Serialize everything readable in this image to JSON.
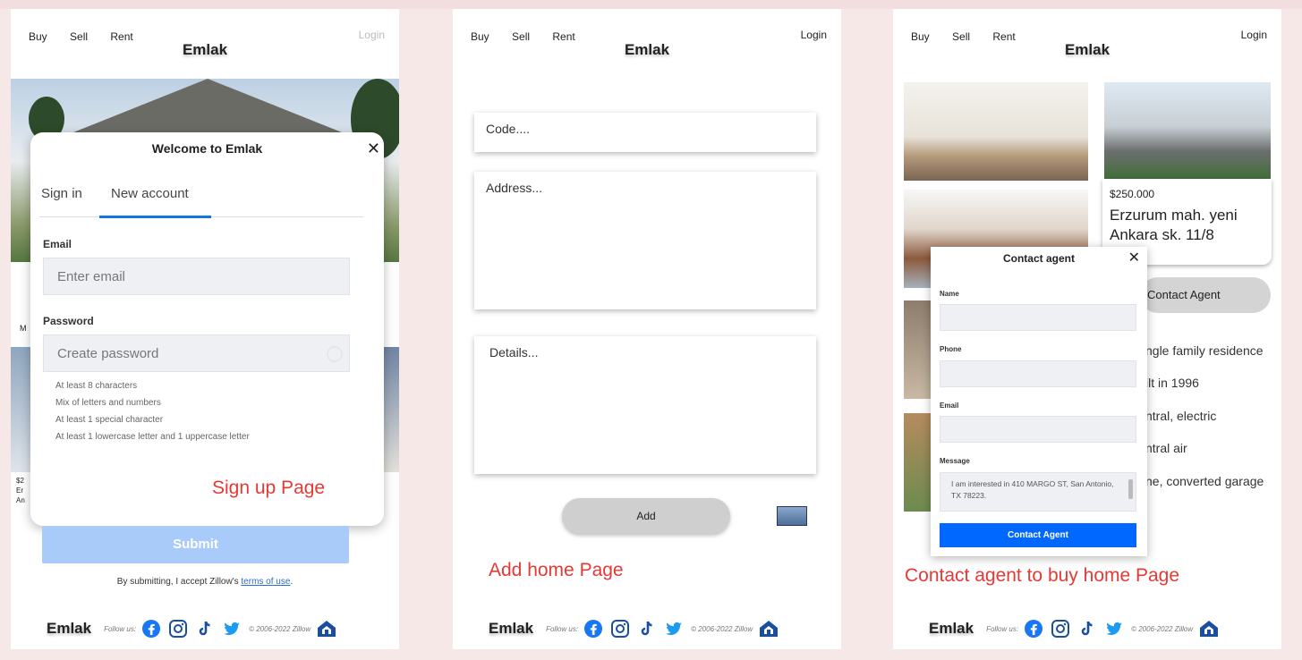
{
  "nav": {
    "buy": "Buy",
    "sell": "Sell",
    "rent": "Rent",
    "login": "Login",
    "brand": "Emlak"
  },
  "footer": {
    "brand": "Emlak",
    "follow": "Follow us:",
    "copyright": "© 2006-2022 Zillow"
  },
  "signup": {
    "title": "Welcome to Emlak",
    "close": "✕",
    "tab_signin": "Sign in",
    "tab_new": "New account",
    "email_label": "Email",
    "email_placeholder": "Enter email",
    "password_label": "Password",
    "password_placeholder": "Create password",
    "rules": [
      "At least 8 characters",
      "Mix of letters and numbers",
      "At least 1 special character",
      "At least 1 lowercase letter and 1 uppercase letter"
    ],
    "submit": "Submit",
    "terms_prefix": "By submitting, I accept Zillow's ",
    "terms_link": "terms of use",
    "terms_suffix": ".",
    "caption": "Sign up Page",
    "bg_card_lines": [
      "$2",
      "Er",
      "An"
    ],
    "bg_letter": "M"
  },
  "addhome": {
    "code_placeholder": "Code....",
    "address_placeholder": "Address...",
    "details_placeholder": "Details...",
    "add_button": "Add",
    "caption": "Add home Page"
  },
  "contact": {
    "price": "$250.000",
    "address": "Erzurum mah. yeni Ankara sk. 11/8",
    "contact_agent_bg": "Contact Agent",
    "features": [
      "ngle family residence",
      "ilt in 1996",
      "ntral, electric",
      "ntral air",
      "ne, converted garage"
    ],
    "modal_title": "Contact agent",
    "close": "✕",
    "name_label": "Name",
    "phone_label": "Phone",
    "email_label": "Email",
    "message_label": "Message",
    "message_text": "I am interested in 410 MARGO ST, San Antonio, TX 78223.",
    "button": "Contact Agent",
    "caption": "Contact agent to buy home Page"
  },
  "colors": {
    "accent": "#0068ff",
    "caption": "#e53935",
    "submit_disabled": "#a8cbfa",
    "tab_underline": "#1277e1"
  },
  "icons": [
    "facebook-icon",
    "instagram-icon",
    "tiktok-icon",
    "twitter-icon",
    "home-logo-icon"
  ]
}
